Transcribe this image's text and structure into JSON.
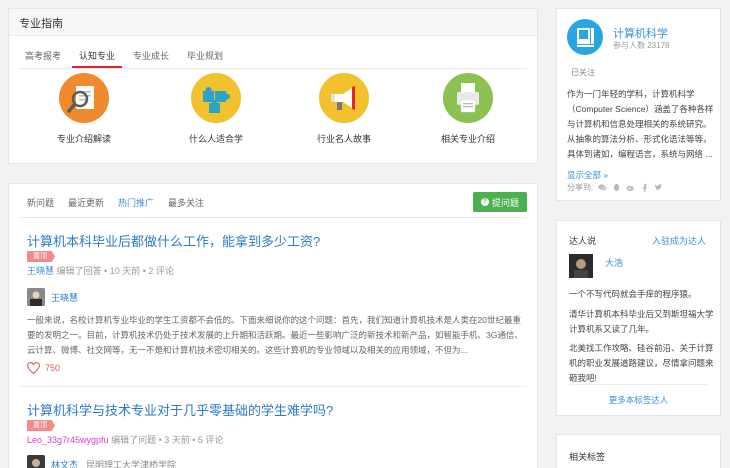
{
  "guide": {
    "title": "专业指南",
    "tabs": [
      "高考报考",
      "认知专业",
      "专业成长",
      "毕业规划"
    ],
    "active_tab": 1,
    "items": [
      {
        "label": "专业介绍解读",
        "icon": "magnifier-document-icon",
        "color": "#f08a2d"
      },
      {
        "label": "什么人适合学",
        "icon": "puzzle-icon",
        "color": "#f2c12e"
      },
      {
        "label": "行业名人故事",
        "icon": "megaphone-icon",
        "color": "#f2c12e"
      },
      {
        "label": "相关专业介绍",
        "icon": "printer-icon",
        "color": "#8cc152"
      }
    ]
  },
  "feed": {
    "tabs": [
      "新问题",
      "最近更新",
      "热门推广",
      "最多关注"
    ],
    "active_tab": 2,
    "ask_button": "提问题",
    "questions": [
      {
        "title": "计算机本科毕业后都做什么工作，能拿到多少工资?",
        "badge": "置顶",
        "meta_user": "王晓慧",
        "meta_text": "编辑了回答 • 10 天前 • 2 评论",
        "answer_author": "王晓慧",
        "excerpt": "一般来说，名校计算机专业毕业的学生工资都不会低的。下面来细说你的这个问题：首先，我们知道计算机技术是人类在20世纪最重要的发明之一。目前，计算机技术仍处于技术发展的上升期和活跃期。最近一些影响广泛的新技术和新产品，如智能手机、3G通信、云计算、微博、社交网等，无一不是和计算机技术密切相关的。这些计算机的专业领域以及相关的应用领域，不但为...",
        "likes": "750"
      },
      {
        "title": "计算机科学与技术专业对于几乎零基础的学生难学吗?",
        "badge": "置顶",
        "meta_user": "Leo_33g7r45wygpfu",
        "meta_text": "编辑了问题 • 3 天前 • 5 评论",
        "answer_author": "林文杰",
        "answer_org": "昆明理工大学津桥学院"
      }
    ]
  },
  "topic": {
    "name": "计算机科学",
    "participants": "参与人数 23178",
    "follow_state": "已关注",
    "description": "作为一门年轻的学科，计算机科学（Computer Science）涵盖了各种各样与计算机和信息处理相关的系统研究。从抽象的算法分析、形式化语法等等，具体到诸如，编程语言，系统与网络 ...",
    "show_all": "显示全部 »",
    "share_label": "分享到:"
  },
  "experts": {
    "title": "达人说",
    "join": "入驻成为达人",
    "name": "大浩",
    "paragraphs": [
      "一个不写代码就会手痒的程序猿。",
      "清华计算机本科毕业后又到斯坦福大学计算机系又读了几年。",
      "北美找工作攻略、硅谷前沿、关于计算机的职业发展道路建议，尽情拿问题来砸我吧!"
    ],
    "more": "更多本标签达人"
  },
  "tags": {
    "title": "相关标签"
  }
}
